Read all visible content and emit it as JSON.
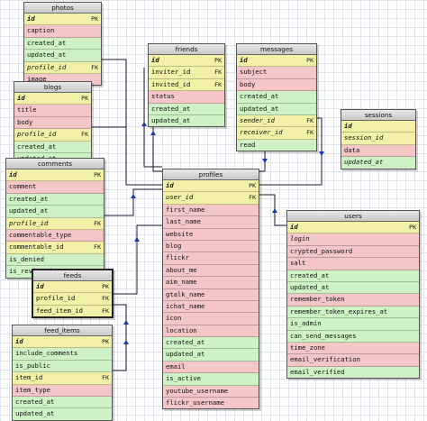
{
  "tables": {
    "photos": {
      "title": "photos",
      "rows": [
        {
          "name": "id",
          "tag": "PK",
          "c": "pk",
          "key": true
        },
        {
          "name": "caption",
          "tag": "",
          "c": "r"
        },
        {
          "name": "created_at",
          "tag": "",
          "c": "g"
        },
        {
          "name": "updated_at",
          "tag": "",
          "c": "g"
        },
        {
          "name": "profile_id",
          "tag": "FK",
          "c": "fk",
          "ital": true
        },
        {
          "name": "image",
          "tag": "",
          "c": "r"
        }
      ]
    },
    "friends": {
      "title": "friends",
      "rows": [
        {
          "name": "id",
          "tag": "PK",
          "c": "pk",
          "key": true
        },
        {
          "name": "inviter_id",
          "tag": "FK",
          "c": "fk"
        },
        {
          "name": "invited_id",
          "tag": "FK",
          "c": "fk"
        },
        {
          "name": "status",
          "tag": "",
          "c": "r"
        },
        {
          "name": "created_at",
          "tag": "",
          "c": "g"
        },
        {
          "name": "updated_at",
          "tag": "",
          "c": "g"
        }
      ]
    },
    "messages": {
      "title": "messages",
      "rows": [
        {
          "name": "id",
          "tag": "PK",
          "c": "pk",
          "key": true
        },
        {
          "name": "subject",
          "tag": "",
          "c": "r"
        },
        {
          "name": "body",
          "tag": "",
          "c": "r"
        },
        {
          "name": "created_at",
          "tag": "",
          "c": "g"
        },
        {
          "name": "updated_at",
          "tag": "",
          "c": "g"
        },
        {
          "name": "sender_id",
          "tag": "FK",
          "c": "fk",
          "ital": true
        },
        {
          "name": "receiver_id",
          "tag": "FK",
          "c": "fk",
          "ital": true
        },
        {
          "name": "read",
          "tag": "",
          "c": "g"
        }
      ]
    },
    "sessions": {
      "title": "sessions",
      "rows": [
        {
          "name": "id",
          "tag": "",
          "c": "pk",
          "key": true
        },
        {
          "name": "session_id",
          "tag": "",
          "c": "pk",
          "ital": true
        },
        {
          "name": "data",
          "tag": "",
          "c": "r"
        },
        {
          "name": "updated_at",
          "tag": "",
          "c": "g",
          "ital": true
        }
      ]
    },
    "blogs": {
      "title": "blogs",
      "rows": [
        {
          "name": "id",
          "tag": "PK",
          "c": "pk",
          "key": true
        },
        {
          "name": "title",
          "tag": "",
          "c": "r"
        },
        {
          "name": "body",
          "tag": "",
          "c": "r"
        },
        {
          "name": "profile_id",
          "tag": "FK",
          "c": "fk",
          "ital": true
        },
        {
          "name": "created_at",
          "tag": "",
          "c": "g"
        },
        {
          "name": "updated_at",
          "tag": "",
          "c": "g"
        }
      ]
    },
    "comments": {
      "title": "comments",
      "rows": [
        {
          "name": "id",
          "tag": "PK",
          "c": "pk",
          "key": true
        },
        {
          "name": "comment",
          "tag": "",
          "c": "r"
        },
        {
          "name": "created_at",
          "tag": "",
          "c": "g"
        },
        {
          "name": "updated_at",
          "tag": "",
          "c": "g"
        },
        {
          "name": "profile_id",
          "tag": "FK",
          "c": "fk",
          "ital": true
        },
        {
          "name": "commentable_type",
          "tag": "",
          "c": "r"
        },
        {
          "name": "commentable_id",
          "tag": "FK",
          "c": "fk"
        },
        {
          "name": "is_denied",
          "tag": "",
          "c": "g"
        },
        {
          "name": "is_reviewed",
          "tag": "",
          "c": "g"
        }
      ]
    },
    "profiles": {
      "title": "profiles",
      "rows": [
        {
          "name": "id",
          "tag": "PK",
          "c": "pk",
          "key": true
        },
        {
          "name": "user_id",
          "tag": "FK",
          "c": "fk",
          "ital": true
        },
        {
          "name": "first_name",
          "tag": "",
          "c": "r"
        },
        {
          "name": "last_name",
          "tag": "",
          "c": "r"
        },
        {
          "name": "website",
          "tag": "",
          "c": "r"
        },
        {
          "name": "blog",
          "tag": "",
          "c": "r"
        },
        {
          "name": "flickr",
          "tag": "",
          "c": "r"
        },
        {
          "name": "about_me",
          "tag": "",
          "c": "r"
        },
        {
          "name": "aim_name",
          "tag": "",
          "c": "r"
        },
        {
          "name": "gtalk_name",
          "tag": "",
          "c": "r"
        },
        {
          "name": "ichat_name",
          "tag": "",
          "c": "r"
        },
        {
          "name": "icon",
          "tag": "",
          "c": "r"
        },
        {
          "name": "location",
          "tag": "",
          "c": "r"
        },
        {
          "name": "created_at",
          "tag": "",
          "c": "g"
        },
        {
          "name": "updated_at",
          "tag": "",
          "c": "g"
        },
        {
          "name": "email",
          "tag": "",
          "c": "r"
        },
        {
          "name": "is_active",
          "tag": "",
          "c": "g"
        },
        {
          "name": "youtube_username",
          "tag": "",
          "c": "r"
        },
        {
          "name": "flickr_username",
          "tag": "",
          "c": "r"
        }
      ]
    },
    "users": {
      "title": "users",
      "rows": [
        {
          "name": "id",
          "tag": "PK",
          "c": "pk",
          "key": true
        },
        {
          "name": "login",
          "tag": "",
          "c": "r",
          "ital": true
        },
        {
          "name": "crypted_password",
          "tag": "",
          "c": "r"
        },
        {
          "name": "salt",
          "tag": "",
          "c": "r"
        },
        {
          "name": "created_at",
          "tag": "",
          "c": "g"
        },
        {
          "name": "updated_at",
          "tag": "",
          "c": "g"
        },
        {
          "name": "remember_token",
          "tag": "",
          "c": "r"
        },
        {
          "name": "remember_token_expires_at",
          "tag": "",
          "c": "g"
        },
        {
          "name": "is_admin",
          "tag": "",
          "c": "g"
        },
        {
          "name": "can_send_messages",
          "tag": "",
          "c": "g"
        },
        {
          "name": "time_zone",
          "tag": "",
          "c": "r"
        },
        {
          "name": "email_verification",
          "tag": "",
          "c": "r"
        },
        {
          "name": "email_verified",
          "tag": "",
          "c": "g"
        }
      ]
    },
    "feeds": {
      "title": "feeds",
      "rows": [
        {
          "name": "id",
          "tag": "PK",
          "c": "pk",
          "key": true
        },
        {
          "name": "profile_id",
          "tag": "FK",
          "c": "fk"
        },
        {
          "name": "feed_item_id",
          "tag": "FK",
          "c": "fk"
        }
      ]
    },
    "feed_items": {
      "title": "feed_items",
      "rows": [
        {
          "name": "id",
          "tag": "PK",
          "c": "pk",
          "key": true
        },
        {
          "name": "include_comments",
          "tag": "",
          "c": "g"
        },
        {
          "name": "is_public",
          "tag": "",
          "c": "g"
        },
        {
          "name": "item_id",
          "tag": "FK",
          "c": "fk"
        },
        {
          "name": "item_type",
          "tag": "",
          "c": "r"
        },
        {
          "name": "created_at",
          "tag": "",
          "c": "g"
        },
        {
          "name": "updated_at",
          "tag": "",
          "c": "g"
        }
      ]
    }
  }
}
